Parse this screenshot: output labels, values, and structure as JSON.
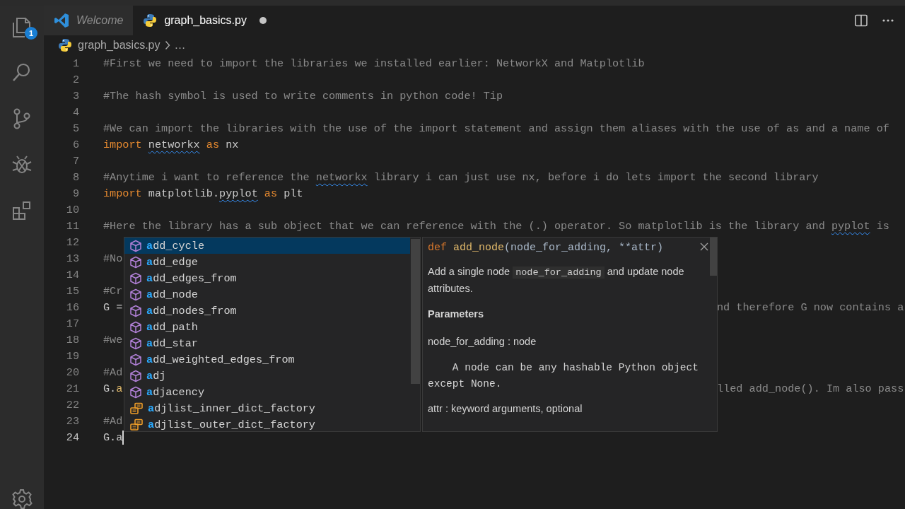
{
  "activity_bar": {
    "items": [
      {
        "kind": "explorer",
        "badge": "1"
      },
      {
        "kind": "search"
      },
      {
        "kind": "source-control"
      },
      {
        "kind": "debug"
      },
      {
        "kind": "extensions"
      }
    ],
    "bottom": [
      {
        "kind": "settings"
      }
    ]
  },
  "tabs": [
    {
      "label": "Welcome",
      "kind": "vscode",
      "selected": false,
      "preview": true,
      "modified": false
    },
    {
      "label": "graph_basics.py",
      "kind": "python",
      "selected": true,
      "preview": false,
      "modified": true
    }
  ],
  "breadcrumb": [
    {
      "label": "graph_basics.py",
      "kind": "python"
    },
    {
      "label": "…"
    }
  ],
  "editor": {
    "lines": [
      {
        "number": "1",
        "cursor": false,
        "tokens": [
          {
            "kind": "comment",
            "text": "#First we need to import the libraries we installed earlier: NetworkX and Matplotlib"
          }
        ]
      },
      {
        "number": "2",
        "cursor": false
      },
      {
        "number": "3",
        "cursor": false,
        "tokens": [
          {
            "kind": "comment",
            "text": "#The hash symbol is used to write comments in python code! Tip"
          }
        ]
      },
      {
        "number": "4",
        "cursor": false
      },
      {
        "number": "5",
        "cursor": false,
        "tokens": [
          {
            "kind": "comment",
            "text": "#We can import the libraries with the use of the import statement and assign them aliases with the use of as and a name of"
          }
        ]
      },
      {
        "number": "6",
        "cursor": false,
        "tokens": [
          {
            "kind": "keyword",
            "text": "import "
          },
          {
            "kind": "warn",
            "text": "networkx"
          },
          {
            "kind": "keyword",
            "text": " as"
          },
          {
            "kind": "plain",
            "text": " nx"
          }
        ]
      },
      {
        "number": "7",
        "cursor": false
      },
      {
        "number": "8",
        "cursor": false,
        "tokens": [
          {
            "kind": "comment",
            "text": "#Anytime i want to reference the "
          },
          {
            "kind": "warn-comment",
            "text": "networkx"
          },
          {
            "kind": "comment",
            "text": " library i can just use nx, before i do lets import the second library"
          }
        ]
      },
      {
        "number": "9",
        "cursor": false,
        "tokens": [
          {
            "kind": "keyword",
            "text": "import"
          },
          {
            "kind": "plain",
            "text": " matplotlib."
          },
          {
            "kind": "warn",
            "text": "pyplot"
          },
          {
            "kind": "keyword",
            "text": " as"
          },
          {
            "kind": "plain",
            "text": " plt"
          }
        ]
      },
      {
        "number": "10",
        "cursor": false
      },
      {
        "number": "11",
        "cursor": false,
        "tokens": [
          {
            "kind": "comment",
            "text": "#Here the library has a sub object that we can reference with the (.) operator. So matplotlib is the library and "
          },
          {
            "kind": "warn-comment",
            "text": "pyplot"
          },
          {
            "kind": "comment",
            "text": " is"
          }
        ]
      },
      {
        "number": "12",
        "cursor": false
      },
      {
        "number": "13",
        "cursor": false,
        "tokens": [
          {
            "kind": "comment",
            "text": "#No"
          }
        ]
      },
      {
        "number": "14",
        "cursor": false
      },
      {
        "number": "15",
        "cursor": false,
        "tokens": [
          {
            "kind": "comment",
            "text": "#Cr"
          }
        ]
      },
      {
        "number": "16",
        "cursor": false,
        "tokens": [
          {
            "kind": "plain",
            "text": "G ="
          }
        ],
        "tail": [
          {
            "kind": "comment",
            "text": "nd therefore G now contains a"
          }
        ]
      },
      {
        "number": "17",
        "cursor": false
      },
      {
        "number": "18",
        "cursor": false,
        "tokens": [
          {
            "kind": "comment",
            "text": "#we"
          }
        ]
      },
      {
        "number": "19",
        "cursor": false
      },
      {
        "number": "20",
        "cursor": false,
        "tokens": [
          {
            "kind": "comment",
            "text": "#Ad"
          }
        ]
      },
      {
        "number": "21",
        "cursor": false,
        "tokens": [
          {
            "kind": "plain",
            "text": "G."
          },
          {
            "kind": "function",
            "text": "a"
          }
        ],
        "tail": [
          {
            "kind": "comment",
            "text": "lled add_node(). Im also pass"
          }
        ]
      },
      {
        "number": "22",
        "cursor": false
      },
      {
        "number": "23",
        "cursor": false,
        "tokens": [
          {
            "kind": "comment",
            "text": "#Ad"
          }
        ]
      },
      {
        "number": "24",
        "cursor": true,
        "tokens": [
          {
            "kind": "plain",
            "text": "G.a"
          }
        ]
      }
    ]
  },
  "suggest": {
    "items": [
      {
        "label": "**a**dd_cycle",
        "kind": "method",
        "selected": true
      },
      {
        "label": "**a**dd_edge",
        "kind": "method",
        "selected": false
      },
      {
        "label": "**a**dd_edges_from",
        "kind": "method",
        "selected": false
      },
      {
        "label": "**a**dd_node",
        "kind": "method",
        "selected": false
      },
      {
        "label": "**a**dd_nodes_from",
        "kind": "method",
        "selected": false
      },
      {
        "label": "**a**dd_path",
        "kind": "method",
        "selected": false
      },
      {
        "label": "**a**dd_star",
        "kind": "method",
        "selected": false
      },
      {
        "label": "**a**dd_weighted_edges_from",
        "kind": "method",
        "selected": false
      },
      {
        "label": "**a**dj",
        "kind": "method",
        "selected": false
      },
      {
        "label": "**a**djacency",
        "kind": "method",
        "selected": false
      },
      {
        "label": "**a**djlist_inner_dict_factory",
        "kind": "property",
        "selected": false
      },
      {
        "label": "**a**djlist_outer_dict_factory",
        "kind": "property",
        "selected": false
      }
    ]
  },
  "hover": {
    "signature": [
      {
        "kind": "keyword",
        "text": "def "
      },
      {
        "kind": "function",
        "text": "add_node"
      },
      {
        "kind": "plain",
        "text": "(node_for_adding, **attr)"
      }
    ],
    "description": [
      {
        "kind": "text",
        "text": "Add a single node "
      },
      {
        "kind": "code",
        "text": "node_for_adding"
      },
      {
        "kind": "text",
        "text": " and update node attributes."
      }
    ],
    "sections": [
      {
        "kind": "heading",
        "text": "Parameters"
      },
      {
        "kind": "text",
        "text": "node_for_adding : node"
      },
      {
        "kind": "pre",
        "text": "    A node can be any hashable Python object\nexcept None."
      },
      {
        "kind": "text",
        "text": "attr : keyword arguments, optional"
      }
    ]
  }
}
